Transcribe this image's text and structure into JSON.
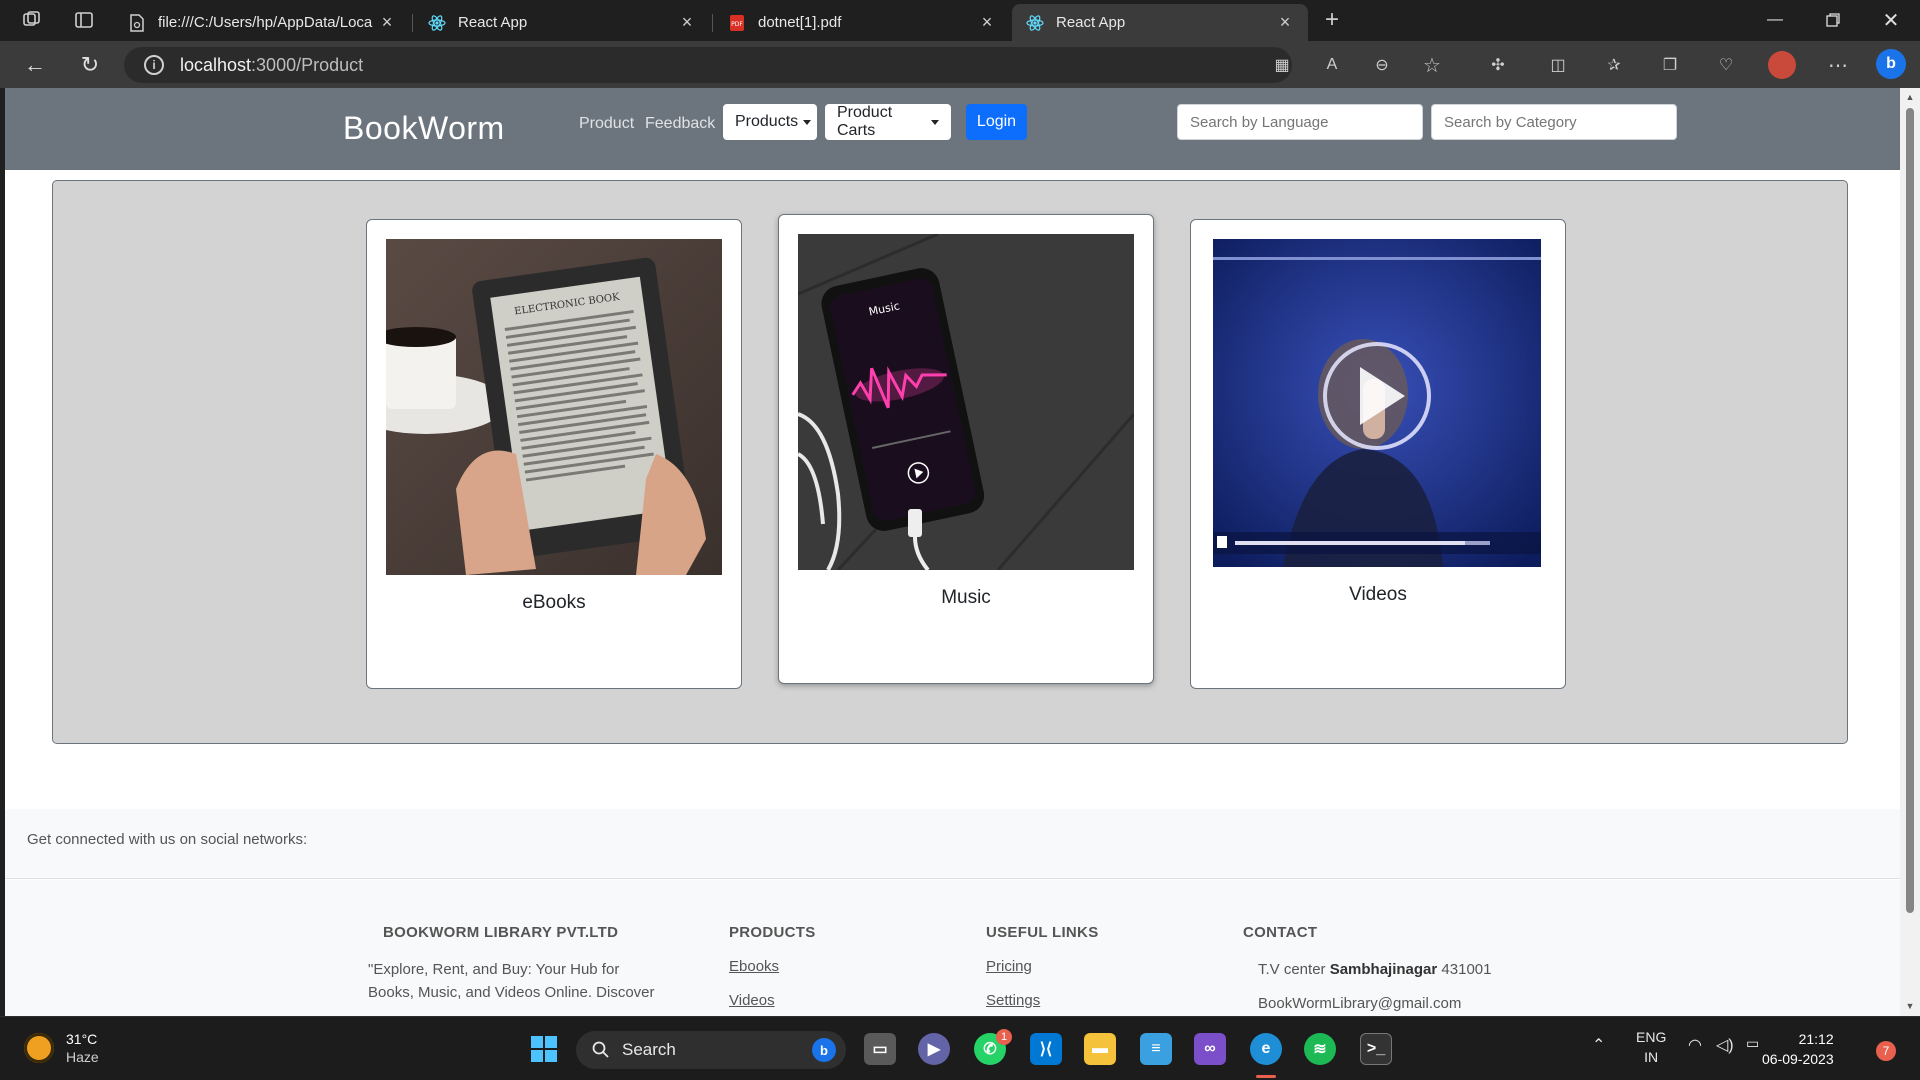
{
  "browser": {
    "tabs": [
      {
        "title": "file:///C:/Users/hp/AppData/Loca",
        "icon": "file-icon",
        "active": false
      },
      {
        "title": "React App",
        "icon": "react-icon",
        "active": false
      },
      {
        "title": "dotnet[1].pdf",
        "icon": "pdf-icon",
        "active": false
      },
      {
        "title": "React App",
        "icon": "react-icon",
        "active": true
      }
    ],
    "address": {
      "host": "localhost",
      "path": ":3000/Product"
    }
  },
  "navbar": {
    "brand": "BookWorm",
    "links": [
      "Product",
      "Feedback"
    ],
    "dropdowns": [
      "Products",
      "Product Carts"
    ],
    "login_label": "Login",
    "search_language_placeholder": "Search by Language",
    "search_category_placeholder": "Search by Category"
  },
  "cards": [
    {
      "name": "eBooks"
    },
    {
      "name": "Music",
      "screen_title": "Music"
    },
    {
      "name": "Videos"
    }
  ],
  "footer": {
    "social_text": "Get connected with us on social networks:",
    "company_heading": "BOOKWORM LIBRARY PVT.LTD",
    "company_text_1": "\"Explore, Rent, and Buy: Your Hub for",
    "company_text_2": "Books, Music, and Videos Online. Discover",
    "products_heading": "PRODUCTS",
    "products_links": [
      "Ebooks",
      "Videos"
    ],
    "useful_heading": "USEFUL LINKS",
    "useful_links": [
      "Pricing",
      "Settings"
    ],
    "contact_heading": "CONTACT",
    "contact_prefix": "T.V center ",
    "contact_city": "Sambhajinagar",
    "contact_pin": " 431001",
    "contact_email": "BookWormLibrary@gmail.com"
  },
  "taskbar": {
    "weather_temp": "31°C",
    "weather_desc": "Haze",
    "search_label": "Search",
    "whatsapp_badge": "1",
    "lang_1": "ENG",
    "lang_2": "IN",
    "time": "21:12",
    "date": "06-09-2023",
    "notifications": "7"
  },
  "colors": {
    "navbar": "#6c757d",
    "primary": "#0d6efd",
    "content_box": "#d3d3d3"
  }
}
